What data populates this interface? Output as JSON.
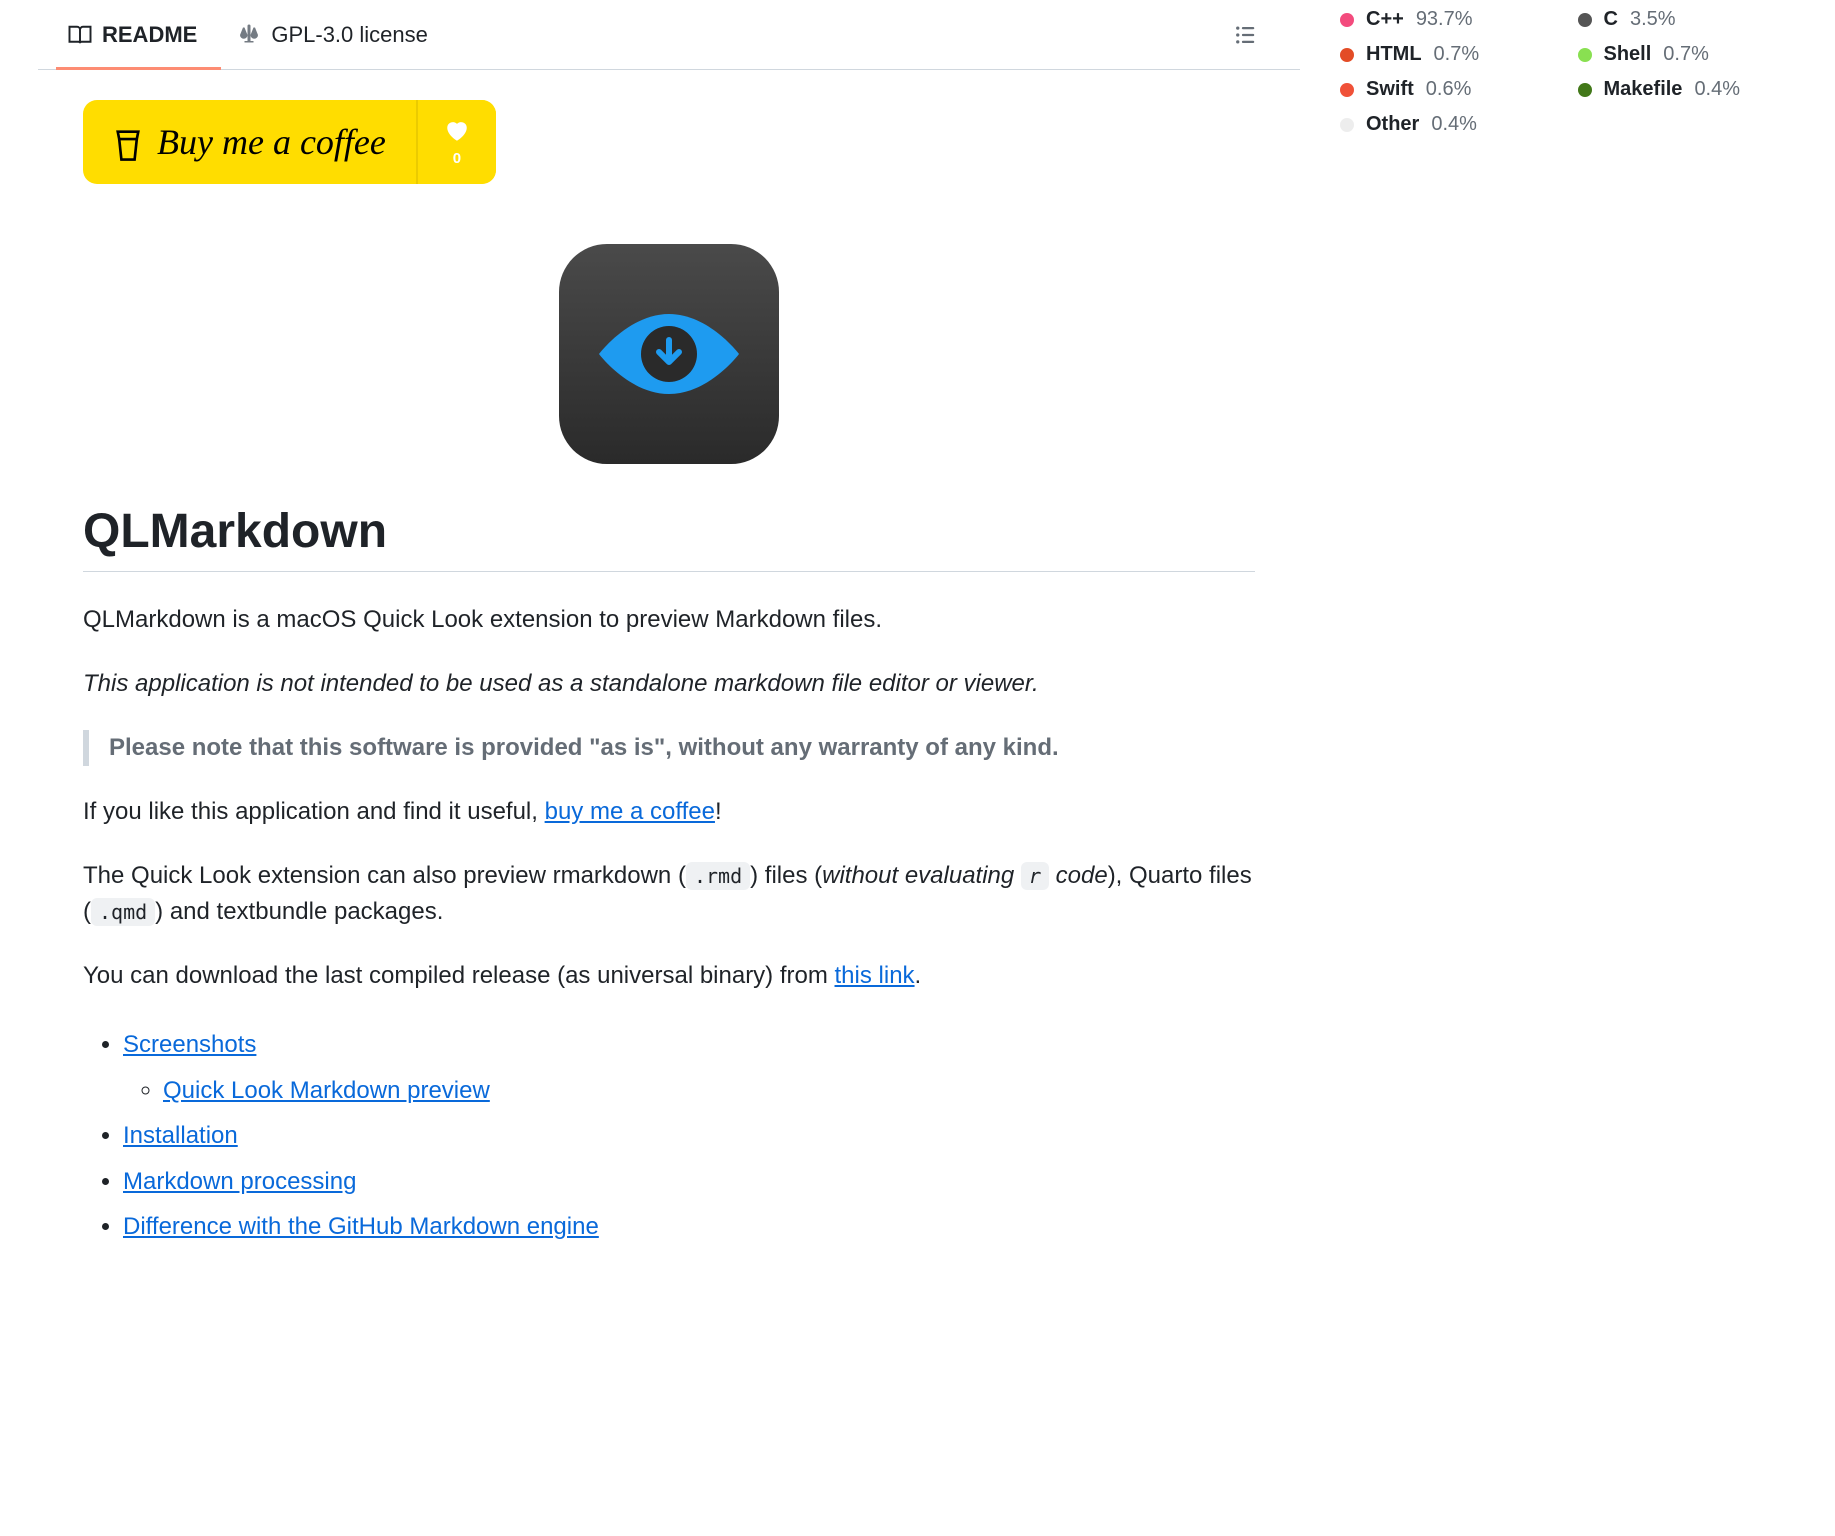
{
  "tabs": {
    "readme": "README",
    "license": "GPL-3.0 license"
  },
  "bmc": {
    "text": "Buy me a coffee",
    "count": "0"
  },
  "title": "QLMarkdown",
  "paragraphs": {
    "intro": "QLMarkdown is a macOS Quick Look extension to preview Markdown files.",
    "disclaimer": "This application is not intended to be used as a standalone markdown file editor or viewer.",
    "note": "Please note that this software is provided \"as is\", without any warranty of any kind.",
    "coffee_pre": "If you like this application and find it useful, ",
    "coffee_link": "buy me a coffee",
    "coffee_post": "!",
    "ql1": "The Quick Look extension can also preview rmarkdown (",
    "ql_code1": ".rmd",
    "ql2": ") files (",
    "ql_without": "without evaluating ",
    "ql_r": "r",
    "ql_code_end": " code",
    "ql3": "), Quarto files (",
    "ql_code2": ".qmd",
    "ql4": ") and textbundle packages.",
    "download_pre": "You can download the last compiled release (as universal binary) from ",
    "download_link": "this link",
    "download_post": "."
  },
  "toc": {
    "screenshots": "Screenshots",
    "quicklook": "Quick Look Markdown preview",
    "installation": "Installation",
    "markdown_processing": "Markdown processing",
    "difference": "Difference with the GitHub Markdown engine"
  },
  "languages": [
    {
      "name": "C++",
      "pct": "93.7%",
      "color": "#f34b7d"
    },
    {
      "name": "C",
      "pct": "3.5%",
      "color": "#555555"
    },
    {
      "name": "HTML",
      "pct": "0.7%",
      "color": "#e34c26"
    },
    {
      "name": "Shell",
      "pct": "0.7%",
      "color": "#89e051"
    },
    {
      "name": "Swift",
      "pct": "0.6%",
      "color": "#f05138"
    },
    {
      "name": "Makefile",
      "pct": "0.4%",
      "color": "#427819"
    },
    {
      "name": "Other",
      "pct": "0.4%",
      "color": "#ededed"
    }
  ]
}
